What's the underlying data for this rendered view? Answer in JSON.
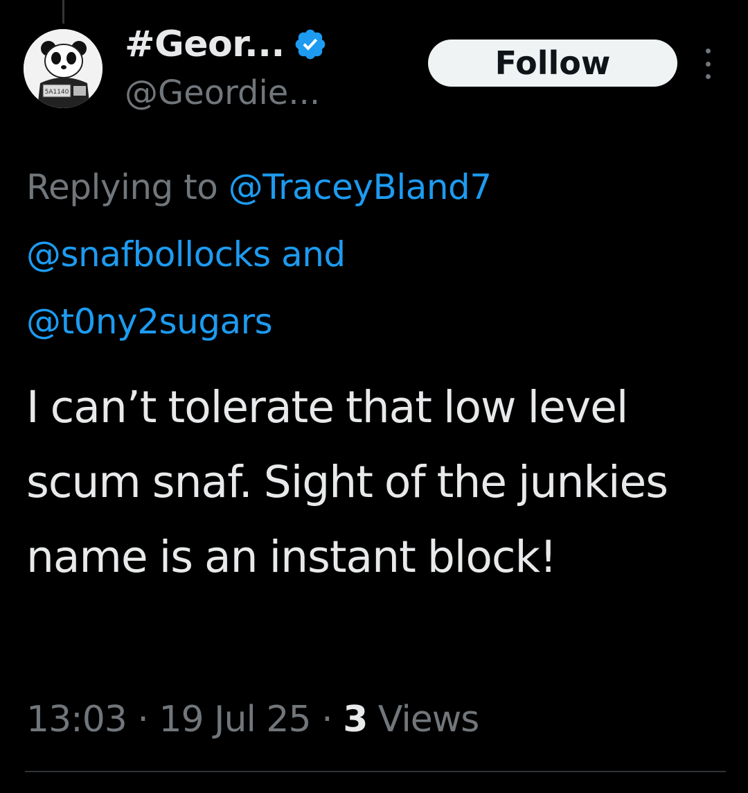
{
  "author": {
    "display_name": "#Geor...",
    "handle": "@Geordie...",
    "verified": true,
    "avatar_badge_text": "5A1140"
  },
  "follow_button": {
    "label": "Follow"
  },
  "reply_context": {
    "prefix": "Replying to",
    "mentions": [
      "@TraceyBland7",
      "@snafbollocks",
      "@t0ny2sugars"
    ],
    "conjunction": "and"
  },
  "tweet": {
    "text": "I can’t tolerate that low level scum snaf. Sight of the junkies name is an instant block!"
  },
  "meta": {
    "time": "13:03",
    "separator": "·",
    "date": "19 Jul 25",
    "views_count": "3",
    "views_label": "Views"
  },
  "colors": {
    "background": "#000000",
    "primary_text": "#e7e9ea",
    "secondary_text": "#71767b",
    "link": "#1d9bf0",
    "follow_button_bg": "#eff3f4",
    "follow_button_text": "#0f1419",
    "divider": "#2f3336"
  },
  "icons": {
    "verified": "verified-badge-icon",
    "more": "more-options-icon"
  }
}
